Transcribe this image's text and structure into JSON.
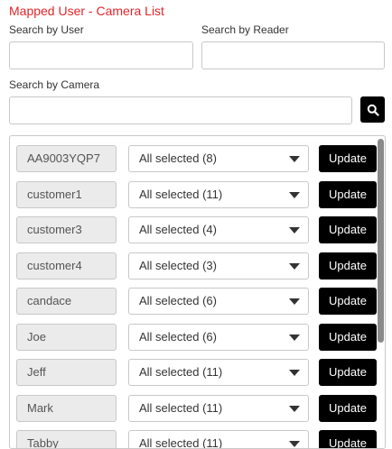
{
  "title": "Mapped User - Camera List",
  "search": {
    "user_label": "Search by User",
    "user_value": "",
    "reader_label": "Search by Reader",
    "reader_value": "",
    "camera_label": "Search by Camera",
    "camera_value": ""
  },
  "rows": [
    {
      "user": "AA9003YQP7",
      "selection": "All selected (8)",
      "button": "Update"
    },
    {
      "user": "customer1",
      "selection": "All selected (11)",
      "button": "Update"
    },
    {
      "user": "customer3",
      "selection": "All selected (4)",
      "button": "Update"
    },
    {
      "user": "customer4",
      "selection": "All selected (3)",
      "button": "Update"
    },
    {
      "user": "candace",
      "selection": "All selected (6)",
      "button": "Update"
    },
    {
      "user": "Joe",
      "selection": "All selected (6)",
      "button": "Update"
    },
    {
      "user": "Jeff",
      "selection": "All selected (11)",
      "button": "Update"
    },
    {
      "user": "Mark",
      "selection": "All selected (11)",
      "button": "Update"
    },
    {
      "user": "Tabby",
      "selection": "All selected (11)",
      "button": "Update"
    }
  ]
}
